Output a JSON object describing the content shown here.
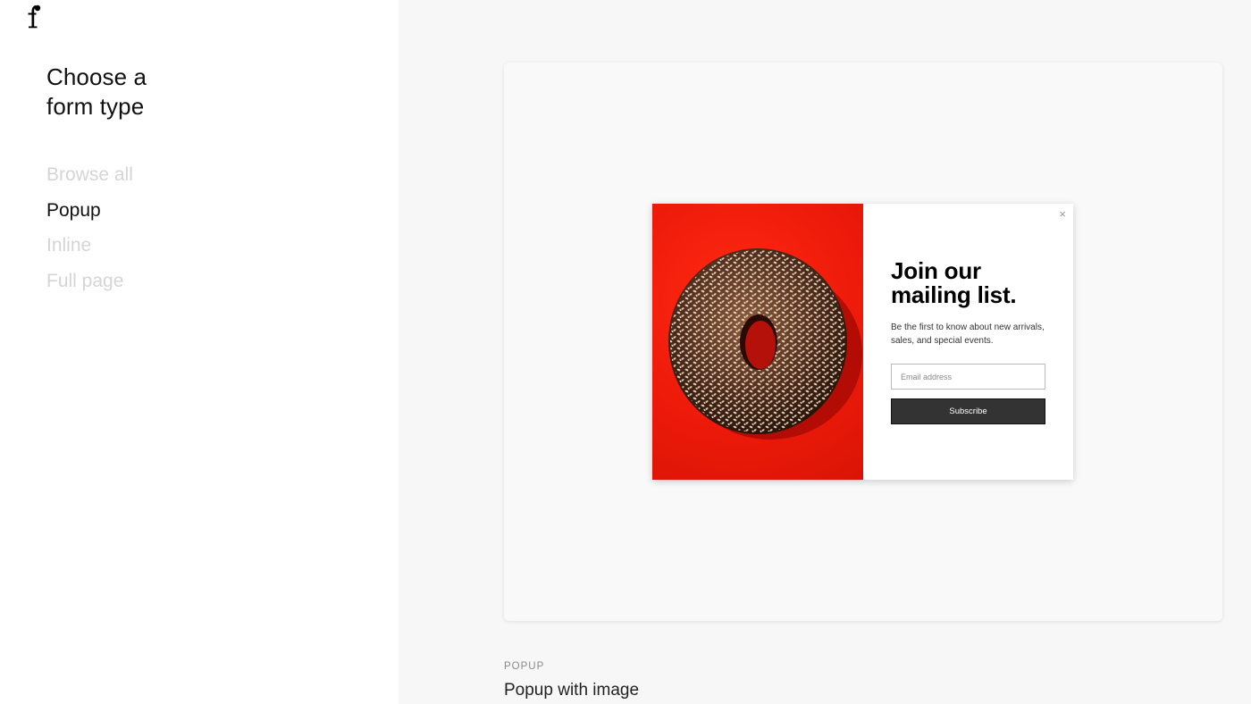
{
  "sidebar": {
    "logo_icon": "f-logo-icon",
    "title": "Choose a\nform type",
    "nav": [
      {
        "label": "Browse all",
        "active": false
      },
      {
        "label": "Popup",
        "active": true
      },
      {
        "label": "Inline",
        "active": false
      },
      {
        "label": "Full page",
        "active": false
      }
    ]
  },
  "preview": {
    "popup": {
      "image": "sesame-donut-on-red-background",
      "close_icon": "×",
      "heading": "Join our\nmailing list.",
      "description": "Be the first to know about new arrivals, sales, and special events.",
      "email_placeholder": "Email address",
      "submit_label": "Subscribe"
    }
  },
  "template": {
    "category": "POPUP",
    "name": "Popup with image"
  },
  "colors": {
    "sidebar_bg": "#ffffff",
    "main_bg": "#f7f7f7",
    "active_nav": "#111111",
    "inactive_nav": "#d5d5d5",
    "popup_image_bg": "#ee1a0a",
    "subscribe_button": "#333333"
  }
}
